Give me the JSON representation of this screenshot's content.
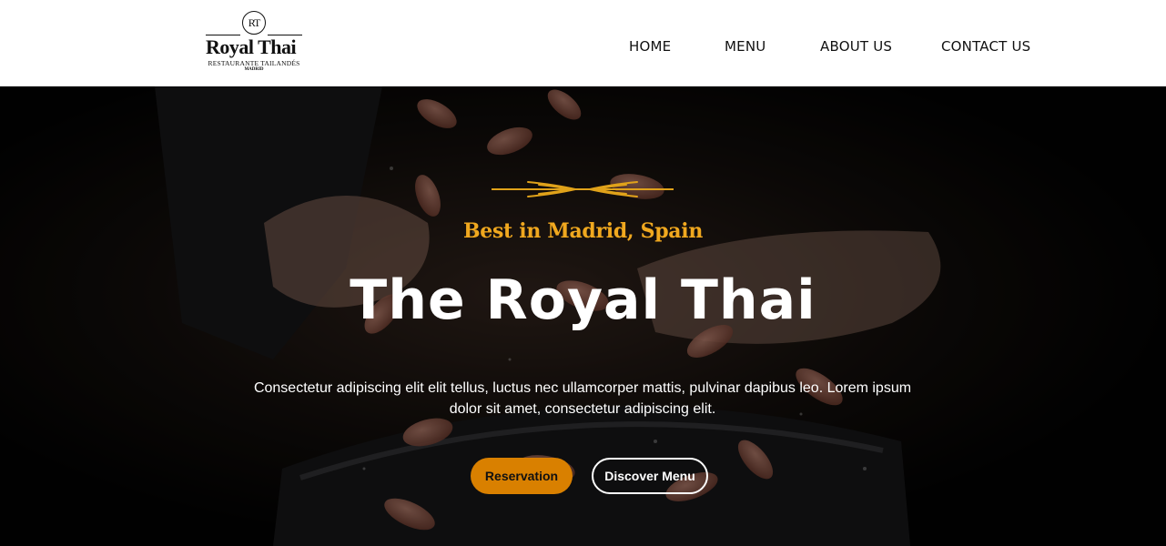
{
  "logo": {
    "monogram": "RT",
    "name": "Royal Thai",
    "subtitle": "RESTAURANTE TAILANDÉS",
    "city": "MADRID"
  },
  "nav": {
    "items": [
      {
        "label": "HOME"
      },
      {
        "label": "MENU"
      },
      {
        "label": "ABOUT US"
      },
      {
        "label": "CONTACT US"
      }
    ]
  },
  "hero": {
    "tagline": "Best in Madrid, Spain",
    "title": "The Royal Thai",
    "description": "Consectetur adipiscing elit elit tellus, luctus nec ullamcorper mattis, pulvinar dapibus leo. Lorem ipsum dolor sit amet, consectetur adipiscing elit.",
    "primary_button": "Reservation",
    "secondary_button": "Discover Menu"
  },
  "colors": {
    "accent": "#f0a81f",
    "button_primary": "#d98000",
    "header_bg": "#ffffff",
    "hero_bg": "#050505"
  }
}
